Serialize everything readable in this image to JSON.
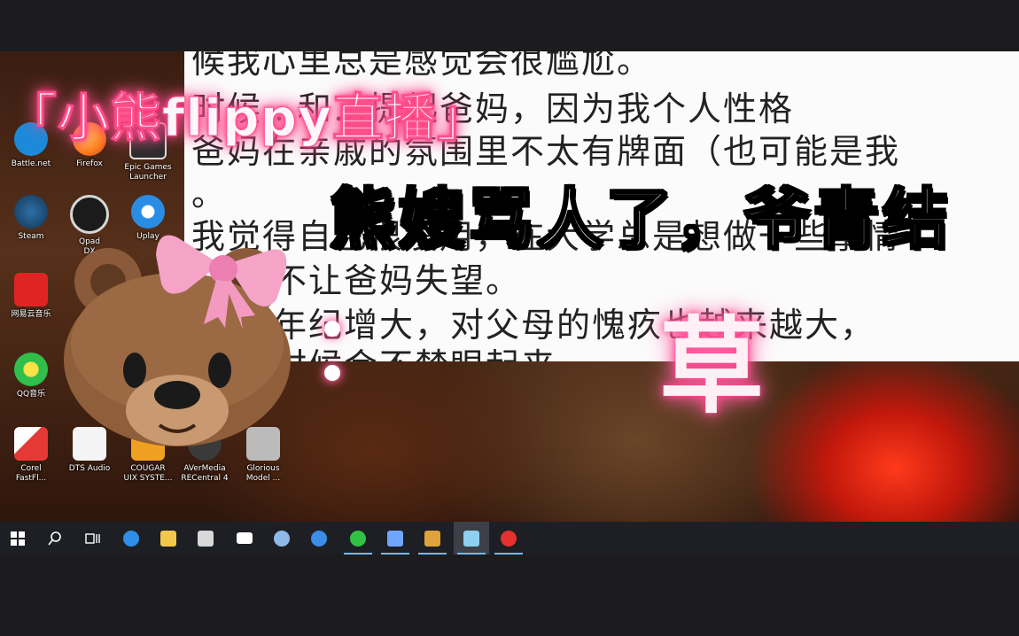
{
  "overlay": {
    "title": "「小熊flippy直播」",
    "subtitle": "熊嫂骂人了，爷青结",
    "cao": "草"
  },
  "document": {
    "lines": [
      "候我心里总是感觉会很尴尬。",
      "时候…和…提起爸妈，因为我个人性格",
      "爸妈在亲戚的氛围里不太有牌面（也可能是我",
      "。",
      "我觉得自己很没用，在大学总是想做一些事情",
      "不让爸妈失望。",
      "年纪增大，对父母的愧疚也越来越大，",
      "时候会不禁眼起来"
    ]
  },
  "desktop_icons": [
    {
      "label": "Battle.net",
      "color": "#1c8ad8"
    },
    {
      "label": "Firefox",
      "color": "#ff7a1a"
    },
    {
      "label": "Epic Games\nLauncher",
      "color": "#2b2b2b"
    },
    {
      "label": "Steam",
      "color": "#1b4e7c"
    },
    {
      "label": "Qpad\nDX",
      "color": "#d6d6d6"
    },
    {
      "label": "Uplay",
      "color": "#2a8de4"
    },
    {
      "label": "网易云音乐",
      "color": "#e02424"
    },
    {
      "label": "QQ音乐",
      "color": "#2fbf4a"
    },
    {
      "label": "Corel\nFastFl...",
      "color": "#e53935"
    },
    {
      "label": "DTS Audio",
      "color": "#f4f4f4"
    },
    {
      "label": "COUGAR\nUIX SYSTE...",
      "color": "#f0a020"
    },
    {
      "label": "AVerMedia\nRECentral 4",
      "color": "#3a3a3a"
    },
    {
      "label": "Glorious\nModel ...",
      "color": "#bbbbbb"
    }
  ],
  "taskbar": {
    "items": [
      {
        "name": "start-icon",
        "color": "#ffffff"
      },
      {
        "name": "search-icon",
        "color": "#ffffff"
      },
      {
        "name": "task-view-icon",
        "color": "#ffffff"
      },
      {
        "name": "edge-icon",
        "color": "#2d8ee8"
      },
      {
        "name": "file-explorer-icon",
        "color": "#f2c84b"
      },
      {
        "name": "store-icon",
        "color": "#d8d8d8"
      },
      {
        "name": "mail-icon",
        "color": "#ffffff"
      },
      {
        "name": "steam-icon",
        "color": "#8fb9e6"
      },
      {
        "name": "app-icon",
        "color": "#3a8ee8"
      },
      {
        "name": "qq-music-icon",
        "color": "#31c245"
      },
      {
        "name": "bird-app-icon",
        "color": "#6ea6ff"
      },
      {
        "name": "game-app-icon",
        "color": "#e0a23a"
      },
      {
        "name": "notepad-icon",
        "color": "#8fd0f0"
      },
      {
        "name": "netease-music-icon",
        "color": "#e5312f"
      }
    ]
  }
}
